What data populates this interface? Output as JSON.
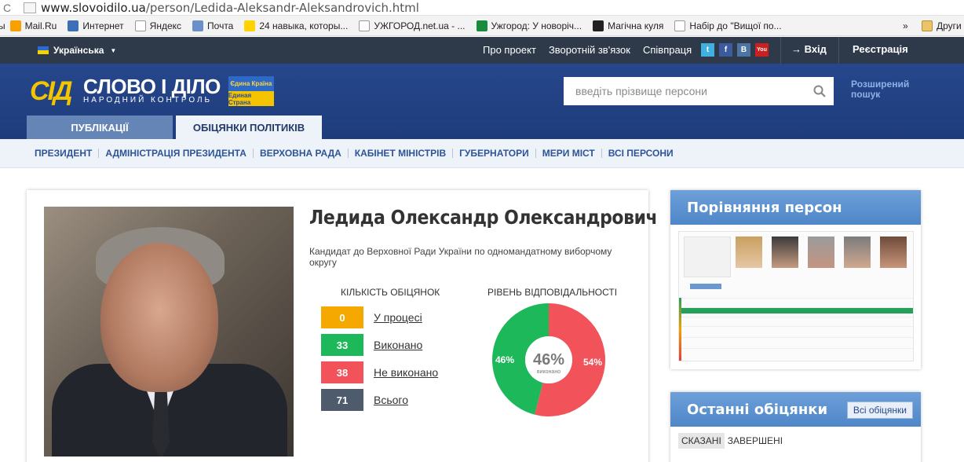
{
  "browser": {
    "url_host": "www.slovoidilo.ua",
    "url_path": "/person/Ledida-Aleksandr-Aleksandrovich.html",
    "bookmarks": [
      {
        "label": "Mail.Ru",
        "icon": "mailru-icon",
        "color": "#f7a000"
      },
      {
        "label": "Интернет",
        "icon": "firefox-icon",
        "color": "#3d6fb6"
      },
      {
        "label": "Яндекс",
        "icon": "page-icon",
        "color": "#ffffff"
      },
      {
        "label": "Почта",
        "icon": "mail-icon",
        "color": "#6b8fc7"
      },
      {
        "label": "24 навыка, которы...",
        "icon": "ad-icon",
        "color": "#ffd200"
      },
      {
        "label": "УЖГОРОД.net.ua - ...",
        "icon": "page-icon",
        "color": "#ffffff"
      },
      {
        "label": "Ужгород: У новоріч...",
        "icon": "green-site-icon",
        "color": "#1a8b3c"
      },
      {
        "label": "Магічна куля",
        "icon": "8ball-icon",
        "color": "#222222"
      },
      {
        "label": "Набір до \"Вищої по...",
        "icon": "page-icon",
        "color": "#ffffff"
      }
    ],
    "bookmarks_more": "»",
    "other_bookmarks": "Други"
  },
  "topbar": {
    "language": "Українська",
    "nav": [
      "Про проект",
      "Зворотній зв'язок",
      "Співпраця"
    ],
    "social": [
      {
        "icon": "twitter-icon",
        "label": "t",
        "color": "#3fb0e0"
      },
      {
        "icon": "facebook-icon",
        "label": "f",
        "color": "#3b5b9e"
      },
      {
        "icon": "vkontakte-icon",
        "label": "B",
        "color": "#4d75a3"
      },
      {
        "icon": "youtube-icon",
        "label": "You",
        "color": "#cc1f1f"
      }
    ],
    "login": "→ Вхід",
    "register": "Реєстрація"
  },
  "header": {
    "logo_mark": "СІД",
    "logo_title": "СЛОВО І ДІЛО",
    "logo_subtitle": "НАРОДНИЙ КОНТРОЛЬ",
    "badge_top": "Єдина Країна",
    "badge_bottom": "Единая Страна",
    "search_placeholder": "введіть прізвище персони",
    "advanced_search": "Розширений пошук",
    "tabs": [
      "ПУБЛІКАЦІЇ",
      "ОБІЦЯНКИ ПОЛІТИКІВ"
    ]
  },
  "subnav": [
    "ПРЕЗИДЕНТ",
    "АДМІНІСТРАЦІЯ ПРЕЗИДЕНТА",
    "ВЕРХОВНА РАДА",
    "КАБІНЕТ МІНІСТРІВ",
    "ГУБЕРНАТОРИ",
    "МЕРИ МІСТ",
    "ВСІ ПЕРСОНИ"
  ],
  "person": {
    "name": "Ледида Олександр Олександрович",
    "description": "Кандидат до Верховної Ради України по одномандатному виборчому округу",
    "promises_title": "КІЛЬКІСТЬ ОБІЦЯНОК",
    "stats": [
      {
        "value": "0",
        "label": "У процесі",
        "color": "#f4a800"
      },
      {
        "value": "33",
        "label": "Виконано",
        "color": "#1db85a"
      },
      {
        "value": "38",
        "label": "Не виконано",
        "color": "#f2525a"
      },
      {
        "value": "71",
        "label": "Всього",
        "color": "#4e5b6d"
      }
    ],
    "responsibility_title": "РІВЕНЬ ВІДПОВІДАЛЬНОСТІ",
    "donut": {
      "done_pct": 46,
      "not_done_pct": 54,
      "center_value": "46%",
      "center_caption": "виконано",
      "left_label": "46%",
      "right_label": "54%",
      "done_color": "#1db85a",
      "not_done_color": "#f2525a"
    }
  },
  "sidebar": {
    "compare_title": "Порівняння персон",
    "latest_title": "Останні обіцянки",
    "all_promises": "Всі обіцянки",
    "filters": [
      "СКАЗАНІ",
      "ЗАВЕРШЕНІ"
    ]
  }
}
